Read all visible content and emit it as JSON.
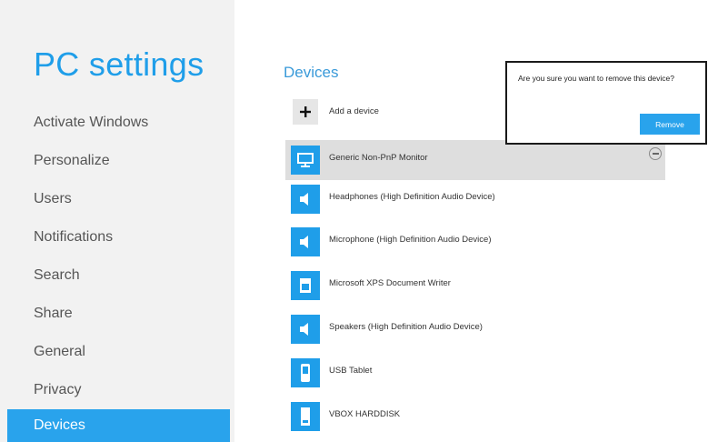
{
  "sidebar": {
    "title": "PC settings",
    "items": [
      {
        "label": "Activate Windows"
      },
      {
        "label": "Personalize"
      },
      {
        "label": "Users"
      },
      {
        "label": "Notifications"
      },
      {
        "label": "Search"
      },
      {
        "label": "Share"
      },
      {
        "label": "General"
      },
      {
        "label": "Privacy"
      },
      {
        "label": "Devices",
        "selected": true
      }
    ]
  },
  "main": {
    "section_title": "Devices",
    "add_device": {
      "label": "Add a device",
      "icon": "plus-icon"
    },
    "devices": [
      {
        "label": "Generic Non-PnP Monitor",
        "icon": "monitor-icon",
        "selected": true
      },
      {
        "label": "Headphones (High Definition Audio Device)",
        "icon": "speaker-icon"
      },
      {
        "label": "Microphone (High Definition Audio Device)",
        "icon": "speaker-icon"
      },
      {
        "label": "Microsoft XPS Document Writer",
        "icon": "printer-icon"
      },
      {
        "label": "Speakers (High Definition Audio Device)",
        "icon": "speaker-icon"
      },
      {
        "label": "USB Tablet",
        "icon": "usb-device-icon"
      },
      {
        "label": "VBOX HARDDISK",
        "icon": "hard-disk-icon"
      }
    ]
  },
  "flyout": {
    "message": "Are you sure you want to remove this device?",
    "button_label": "Remove"
  },
  "colors": {
    "accent": "#29a3ec",
    "sidebar_bg": "#f2f2f2",
    "selected_row": "#dedede"
  }
}
